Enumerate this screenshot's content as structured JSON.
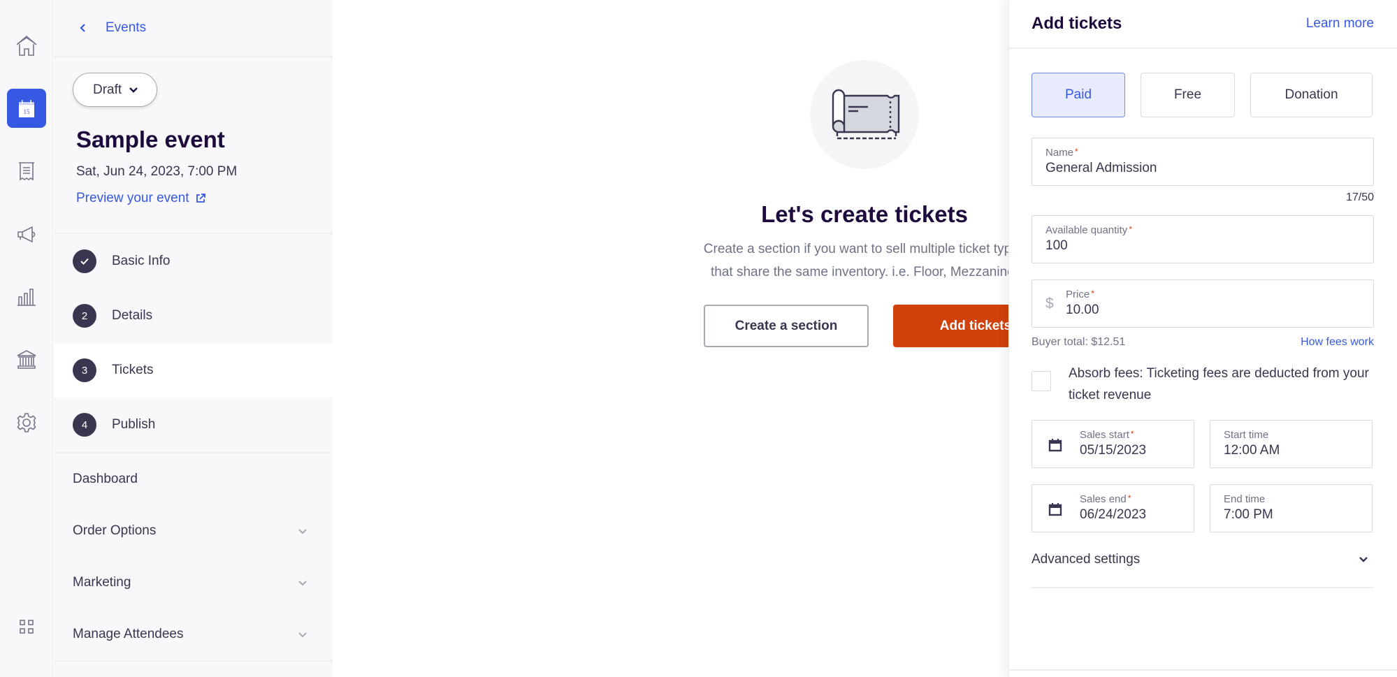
{
  "rail": {
    "items": [
      {
        "name": "home",
        "icon": "home-icon"
      },
      {
        "name": "events",
        "icon": "calendar-icon",
        "active": true,
        "calendar_day": "15"
      },
      {
        "name": "orders",
        "icon": "receipt-icon"
      },
      {
        "name": "marketing",
        "icon": "megaphone-icon"
      },
      {
        "name": "reports",
        "icon": "bar-chart-icon"
      },
      {
        "name": "finance",
        "icon": "bank-icon"
      },
      {
        "name": "settings",
        "icon": "gear-icon"
      },
      {
        "name": "apps",
        "icon": "app-grid-icon"
      }
    ]
  },
  "nav": {
    "back_label": "Events",
    "status": "Draft",
    "event_title": "Sample event",
    "event_date": "Sat, Jun 24, 2023, 7:00 PM",
    "preview_label": "Preview your event",
    "steps": [
      {
        "badge": "",
        "label": "Basic Info",
        "completed": true
      },
      {
        "badge": "2",
        "label": "Details"
      },
      {
        "badge": "3",
        "label": "Tickets",
        "active": true
      },
      {
        "badge": "4",
        "label": "Publish"
      }
    ],
    "menu": [
      {
        "label": "Dashboard",
        "expandable": false
      },
      {
        "label": "Order Options",
        "expandable": true
      },
      {
        "label": "Marketing",
        "expandable": true
      },
      {
        "label": "Manage Attendees",
        "expandable": true
      }
    ]
  },
  "main": {
    "title": "Let's create tickets",
    "description_line1": "Create a section if you want to sell multiple ticket types",
    "description_line2": "that share the same inventory. i.e. Floor, Mezzanine.",
    "create_section_label": "Create a section",
    "add_tickets_label": "Add tickets"
  },
  "panel": {
    "title": "Add tickets",
    "learn_more": "Learn more",
    "ticket_types": [
      "Paid",
      "Free",
      "Donation"
    ],
    "selected_type": "Paid",
    "name": {
      "label": "Name",
      "value": "General Admission",
      "counter": "17/50"
    },
    "quantity": {
      "label": "Available quantity",
      "value": "100"
    },
    "price": {
      "label": "Price",
      "currency": "$",
      "value": "10.00"
    },
    "buyer_total": "Buyer total: $12.51",
    "how_fees_work": "How fees work",
    "absorb_fees_label": "Absorb fees: Ticketing fees are deducted from your ticket revenue",
    "absorb_fees_checked": false,
    "sales_start": {
      "label": "Sales start",
      "value": "05/15/2023"
    },
    "start_time": {
      "label": "Start time",
      "value": "12:00 AM"
    },
    "sales_end": {
      "label": "Sales end",
      "value": "06/24/2023"
    },
    "end_time": {
      "label": "End time",
      "value": "7:00 PM"
    },
    "advanced_settings": "Advanced settings",
    "required_marker": "*"
  },
  "colors": {
    "brand_blue": "#3659e3",
    "primary_orange": "#d1410c",
    "dark_text": "#1e0a3c",
    "body_text": "#39364f",
    "muted_text": "#6f7287"
  }
}
